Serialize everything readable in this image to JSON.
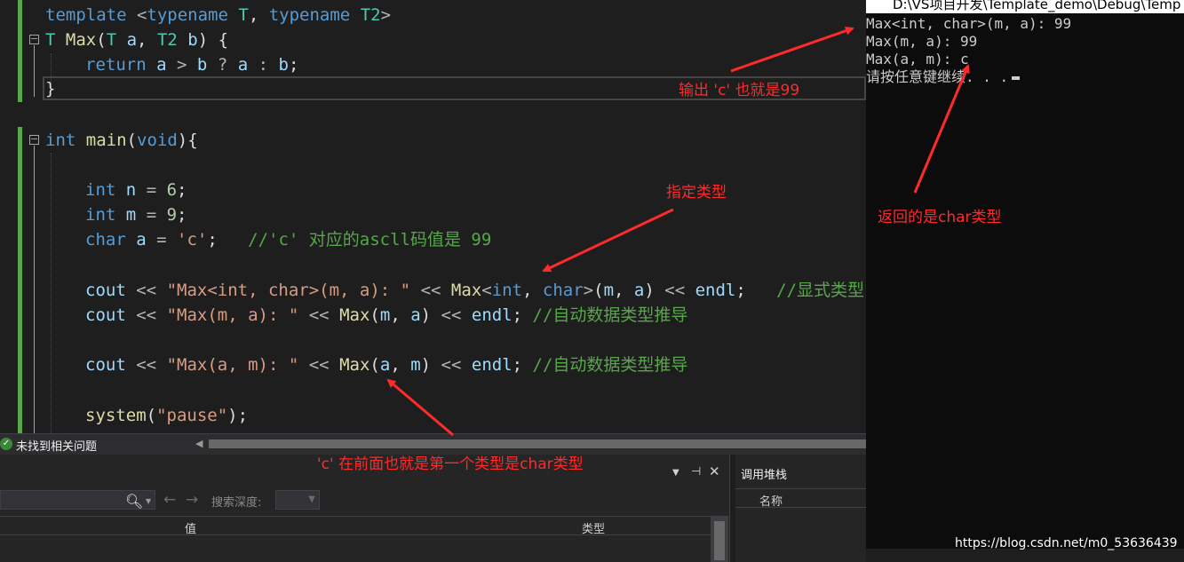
{
  "editor": {
    "lines": [
      "template <typename T, typename T2>",
      "T Max(T a, T2 b) {",
      "return a > b ? a : b;",
      "}",
      "int main(void){",
      "int n = 6;",
      "int m = 9;",
      "char a = 'c';   //'c' 对应的ascll码值是 99",
      "cout << \"Max<int, char>(m, a): \" << Max<int, char>(m, a) << endl;   //显式类型",
      "cout << \"Max(m, a): \" << Max(m, a) << endl; //自动数据类型推导",
      "cout << \"Max(a, m): \" << Max(a, m) << endl; //自动数据类型推导",
      "system(\"pause\");"
    ]
  },
  "status": {
    "ok_icon": "check-circle-icon",
    "message": "未找到相关问题"
  },
  "locals_panel": {
    "search_depth_label": "搜索深度:",
    "columns": [
      "值",
      "类型"
    ],
    "pin_icon": "pin-icon",
    "close_icon": "close-icon",
    "dropdown_icon": "chevron-down-icon"
  },
  "callstack_panel": {
    "title": "调用堆栈",
    "column": "名称"
  },
  "console": {
    "title": "D:\\VS项目开发\\Template_demo\\Debug\\Temp",
    "lines": [
      "Max<int, char>(m, a): 99",
      "Max(m, a): 99",
      "Max(a, m): c",
      "请按任意键继续. . ."
    ]
  },
  "annotations": {
    "output_note": "输出 'c' 也就是99",
    "specify_type_note": "指定类型",
    "returns_char_note": "返回的是char类型",
    "first_type_note": "'c' 在前面也就是第一个类型是char类型"
  },
  "watermark": "https://blog.csdn.net/m0_53636439",
  "colors": {
    "annotation": "#ff2a2a",
    "keyword": "#569cd6",
    "type": "#4ec9b0",
    "function": "#dcdcaa",
    "comment": "#57a64a",
    "string": "#d69d85"
  }
}
